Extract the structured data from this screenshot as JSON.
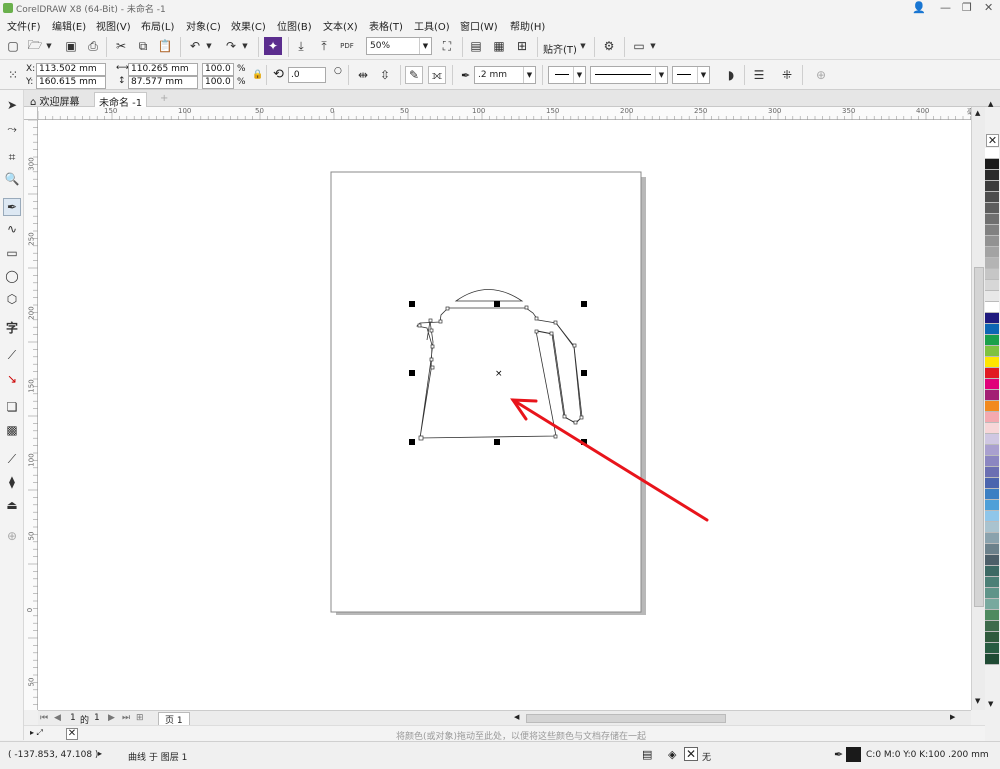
{
  "titlebar": {
    "title": "CorelDRAW X8 (64-Bit) - 未命名 -1"
  },
  "menu": [
    "文件(F)",
    "编辑(E)",
    "视图(V)",
    "布局(L)",
    "对象(C)",
    "效果(C)",
    "位图(B)",
    "文本(X)",
    "表格(T)",
    "工具(O)",
    "窗口(W)",
    "帮助(H)"
  ],
  "toolbar": {
    "zoom": "50%",
    "snap_label": "贴齐(T)",
    "pdf_label": "PDF"
  },
  "propbar": {
    "x": "113.502 mm",
    "y": "160.615 mm",
    "w": "110.265 mm",
    "h": "87.577 mm",
    "sx": "100.0",
    "sy": "100.0",
    "pct": "%",
    "x_label": "X:",
    "y_label": "Y:",
    "rotation": ".0",
    "outline": ".2 mm"
  },
  "tabs": {
    "welcome": "欢迎屏幕",
    "doc": "未命名 -1"
  },
  "hruler_labels": [
    "150",
    "100",
    "50",
    "0",
    "50",
    "100",
    "150",
    "200",
    "250",
    "300",
    "350",
    "400",
    "毫米"
  ],
  "vruler_labels": [
    "300",
    "250",
    "200",
    "150",
    "100",
    "50",
    "0",
    "50"
  ],
  "pagenav": {
    "current": "1",
    "of": "的",
    "total": "1",
    "page_tab": "页 1"
  },
  "colorbar": {
    "hint": "将颜色(或对象)拖动至此处，以便将这些颜色与文档存储在一起"
  },
  "status": {
    "coords": "( -137.853, 47.108 )",
    "info": "曲线 于 图层 1",
    "fill_none": "无",
    "color_info": "C:0 M:0 Y:0 K:100  .200 mm"
  },
  "palette": [
    "#ffffff",
    "#1a1a1a",
    "#2b2b2b",
    "#3c3c3c",
    "#4d4d4d",
    "#5e5e5e",
    "#707070",
    "#818181",
    "#929292",
    "#a3a3a3",
    "#b4b4b4",
    "#c6c6c6",
    "#d7d7d7",
    "#e8e8e8",
    "#ffffff",
    "#1f1a7e",
    "#0d66b3",
    "#1aa04a",
    "#7fc241",
    "#ffe600",
    "#e11a22",
    "#e0007a",
    "#a31f74",
    "#f28a1e",
    "#f4a9b0",
    "#f7d6d8",
    "#cfc7e2",
    "#a9a0cf",
    "#8b86c1",
    "#6b6fb2",
    "#4b65ae",
    "#3b7fc3",
    "#4fa0d8",
    "#8fc6ea",
    "#a9c3cf",
    "#8aa2ad",
    "#6c818b",
    "#4d5f69",
    "#3c6964",
    "#4b7f76",
    "#5f9489",
    "#78a99e",
    "#4e8a5f",
    "#3d6b4b",
    "#2f5a3d",
    "#285c42",
    "#1f4b34"
  ],
  "colors": {
    "arrow": "#e8141b",
    "handle": "#000000"
  }
}
